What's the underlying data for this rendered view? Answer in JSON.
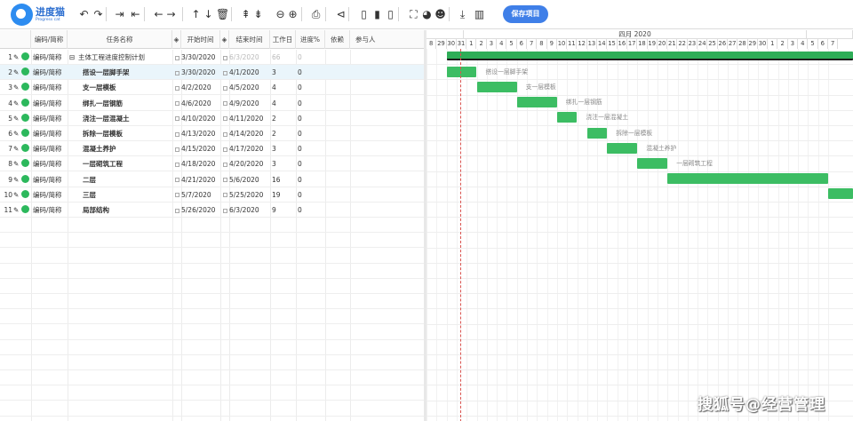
{
  "app": {
    "logo_cn": "进度猫",
    "logo_en": "Progress cat",
    "save_label": "保存项目",
    "watermark": "搜狐号@经营管理"
  },
  "toolbar_icons": [
    "undo-icon",
    "redo-icon",
    "indent-icon",
    "outdent-icon",
    "arrow-left-right-icon",
    "arrow-left-right-2-icon",
    "move-up-icon",
    "move-down-icon",
    "delete-icon",
    "expand-icon",
    "collapse-icon",
    "zoom-out-icon",
    "zoom-in-icon",
    "print-icon",
    "link-icon",
    "layout-left-icon",
    "layout-split-icon",
    "layout-right-icon",
    "fullscreen-icon",
    "palette-icon",
    "users-icon",
    "export-icon",
    "book-icon"
  ],
  "columns": {
    "code": "编码/简称",
    "name": "任务名称",
    "start": "开始时间",
    "end": "结束时间",
    "workdays": "工作日",
    "progress": "进度%",
    "depend": "依赖",
    "members": "参与人"
  },
  "timeline": {
    "month_label": "四月 2020",
    "days": [
      "8",
      "29",
      "30",
      "31",
      "1",
      "2",
      "3",
      "4",
      "5",
      "6",
      "7",
      "8",
      "9",
      "10",
      "11",
      "12",
      "13",
      "14",
      "15",
      "16",
      "17",
      "18",
      "19",
      "20",
      "21",
      "22",
      "23",
      "24",
      "25",
      "26",
      "27",
      "28",
      "29",
      "30",
      "1",
      "2",
      "3",
      "4",
      "5",
      "6",
      "7"
    ]
  },
  "rows": [
    {
      "num": "1",
      "code": "编码/简称",
      "name": "主体工程进度控制计划",
      "start": "3/30/2020",
      "end": "6/3/2020",
      "days": "66",
      "progress": "0",
      "summary": true,
      "bar_label": ""
    },
    {
      "num": "2",
      "code": "编码/简称",
      "name": "搭设一层脚手架",
      "start": "3/30/2020",
      "end": "4/1/2020",
      "days": "3",
      "progress": "0",
      "selected": true,
      "bar_label": "搭设一层脚手架"
    },
    {
      "num": "3",
      "code": "编码/简称",
      "name": "支一层模板",
      "start": "4/2/2020",
      "end": "4/5/2020",
      "days": "4",
      "progress": "0",
      "bar_label": "支一层模板"
    },
    {
      "num": "4",
      "code": "编码/简称",
      "name": "绑扎一层钢筋",
      "start": "4/6/2020",
      "end": "4/9/2020",
      "days": "4",
      "progress": "0",
      "bar_label": "绑扎一层钢筋"
    },
    {
      "num": "5",
      "code": "编码/简称",
      "name": "浇注一层混凝土",
      "start": "4/10/2020",
      "end": "4/11/2020",
      "days": "2",
      "progress": "0",
      "bar_label": "浇注一层混凝土"
    },
    {
      "num": "6",
      "code": "编码/简称",
      "name": "拆除一层模板",
      "start": "4/13/2020",
      "end": "4/14/2020",
      "days": "2",
      "progress": "0",
      "bar_label": "拆除一层模板"
    },
    {
      "num": "7",
      "code": "编码/简称",
      "name": "混凝土养护",
      "start": "4/15/2020",
      "end": "4/17/2020",
      "days": "3",
      "progress": "0",
      "bar_label": "混凝土养护"
    },
    {
      "num": "8",
      "code": "编码/简称",
      "name": "一层砌筑工程",
      "start": "4/18/2020",
      "end": "4/20/2020",
      "days": "3",
      "progress": "0",
      "bar_label": "一层砌筑工程"
    },
    {
      "num": "9",
      "code": "编码/简称",
      "name": "二层",
      "start": "4/21/2020",
      "end": "5/6/2020",
      "days": "16",
      "progress": "0",
      "bar_label": ""
    },
    {
      "num": "10",
      "code": "编码/简称",
      "name": "三层",
      "start": "5/7/2020",
      "end": "5/25/2020",
      "days": "19",
      "progress": "0",
      "bar_label": ""
    },
    {
      "num": "11",
      "code": "编码/简称",
      "name": "局部结构",
      "start": "5/26/2020",
      "end": "6/3/2020",
      "days": "9",
      "progress": "0",
      "bar_label": ""
    }
  ]
}
